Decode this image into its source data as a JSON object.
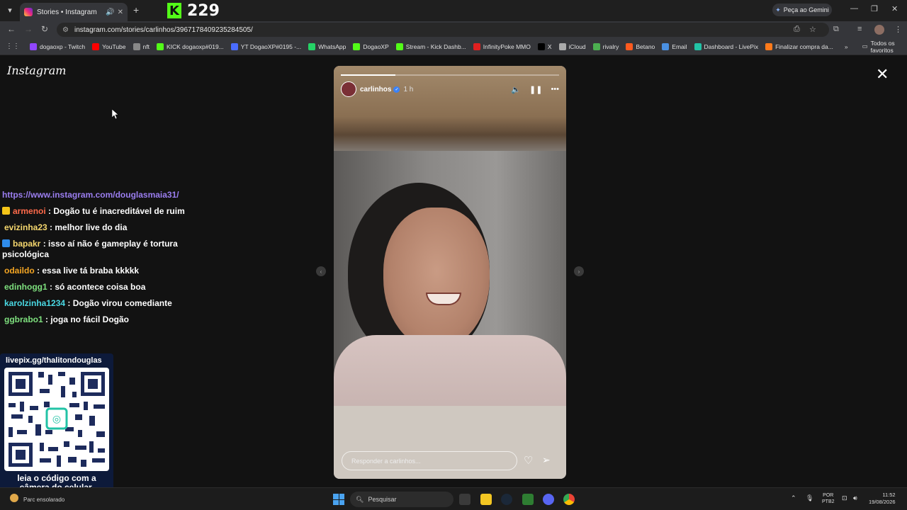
{
  "browser": {
    "tab_title": "Stories • Instagram",
    "new_tab": "+",
    "gemini_label": "Peça ao Gemini",
    "url": "instagram.com/stories/carlinhos/3967178409235284505/"
  },
  "kick_overlay": {
    "logo": "K",
    "viewer_count": "229",
    "brand_color": "#53fc18"
  },
  "bookmarks": [
    {
      "label": "dogaoxp - Twitch",
      "color": "#9146ff"
    },
    {
      "label": "YouTube",
      "color": "#ff0000"
    },
    {
      "label": "nft",
      "color": "#888888"
    },
    {
      "label": "KICK dogaoxp#019...",
      "color": "#53fc18"
    },
    {
      "label": "YT DogaoXP#0195 -...",
      "color": "#4a6cff"
    },
    {
      "label": "WhatsApp",
      "color": "#25d366"
    },
    {
      "label": "DogaoXP",
      "color": "#53fc18"
    },
    {
      "label": "Stream - Kick Dashb...",
      "color": "#53fc18"
    },
    {
      "label": "InfinityPoke MMO",
      "color": "#e02020"
    },
    {
      "label": "X",
      "color": "#000000"
    },
    {
      "label": "iCloud",
      "color": "#aaaaaa"
    },
    {
      "label": "rivalry",
      "color": "#4caf50"
    },
    {
      "label": "Betano",
      "color": "#ff5a1f"
    },
    {
      "label": "Email",
      "color": "#4a90e2"
    },
    {
      "label": "Dashboard - LivePix",
      "color": "#22c3a6"
    },
    {
      "label": "Finalizar compra da...",
      "color": "#ff7a1a"
    }
  ],
  "bookmarks_more": "»",
  "bookmarks_all": "Todos os favoritos",
  "instagram": {
    "logo_text": "Instagram",
    "story": {
      "username": "carlinhos",
      "time_ago": "1 h",
      "reply_placeholder": "Responder a carlinhos...",
      "progress": 0.25
    }
  },
  "chat": {
    "partial_line": "...",
    "link": "https://www.instagram.com/douglasmaia31/",
    "messages": [
      {
        "user": "armenoi",
        "text": "Dogão tu é inacreditável de ruim",
        "color": "#ff6a4a",
        "badge_color": "#f5c518"
      },
      {
        "user": "evizinha23",
        "text": "melhor live do dia",
        "color": "#f5d76e",
        "badge_color": ""
      },
      {
        "user": "bapakr",
        "text": "isso aí não é gameplay é tortura psicológica",
        "color": "#f5d76e",
        "badge_color": "#2f8ceb"
      },
      {
        "user": "odaildo",
        "text": "essa live tá braba kkkkk",
        "color": "#f5a623",
        "badge_color": ""
      },
      {
        "user": "edinhogg1",
        "text": "só acontece coisa boa",
        "color": "#7ee07e",
        "badge_color": ""
      },
      {
        "user": "karolzinha1234",
        "text": "Dogão virou comediante",
        "color": "#4ad9e4",
        "badge_color": ""
      },
      {
        "user": "ggbrabo1",
        "text": "joga no fácil Dogão",
        "color": "#7ee07e",
        "badge_color": ""
      }
    ]
  },
  "qr": {
    "url": "livepix.gg/thalitondouglas",
    "caption": "leia o código com a câmera do celular."
  },
  "taskbar": {
    "weather": "Parc ensolarado",
    "search_placeholder": "Pesquisar",
    "lang_line1": "POR",
    "lang_line2": "PTB2",
    "time": "11:52",
    "date": "19/08/2026"
  }
}
